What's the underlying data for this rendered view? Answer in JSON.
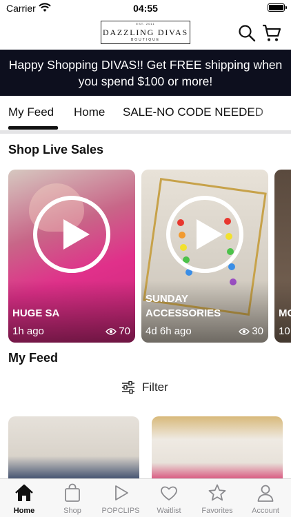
{
  "status_bar": {
    "carrier": "Carrier",
    "time": "04:55"
  },
  "header": {
    "logo": {
      "est": "EST. 2011",
      "name": "DAZZLING DIVAS",
      "sub": "BOUTIQUE"
    }
  },
  "banner": {
    "text": "Happy Shopping DIVAS!! Get FREE shipping when you spend $100 or more!"
  },
  "tabs": [
    {
      "label": "My Feed",
      "active": true
    },
    {
      "label": "Home",
      "active": false
    },
    {
      "label": "SALE-NO CODE NEEDED",
      "active": false
    }
  ],
  "live_section": {
    "title": "Shop Live Sales",
    "cards": [
      {
        "title": "HUGE SA",
        "time": "1h ago",
        "views": "70"
      },
      {
        "title": "SUNDAY ACCESSORIES",
        "time": "4d 6h ago",
        "views": "30"
      },
      {
        "title": "MO NE",
        "time": "10",
        "views": ""
      }
    ]
  },
  "feed_section": {
    "title": "My Feed",
    "filter_label": "Filter"
  },
  "tab_bar": [
    {
      "label": "Home",
      "icon": "home-icon",
      "active": true
    },
    {
      "label": "Shop",
      "icon": "shopping-bag-icon",
      "active": false
    },
    {
      "label": "POPCLIPS",
      "icon": "play-icon",
      "active": false
    },
    {
      "label": "Waitlist",
      "icon": "heart-icon",
      "active": false
    },
    {
      "label": "Favorites",
      "icon": "star-icon",
      "active": false
    },
    {
      "label": "Account",
      "icon": "person-icon",
      "active": false
    }
  ],
  "colors": {
    "banner_bg": "#0d0f1e",
    "accent_pink": "#e0308a",
    "tabbar_bg": "#f7f7f7"
  }
}
